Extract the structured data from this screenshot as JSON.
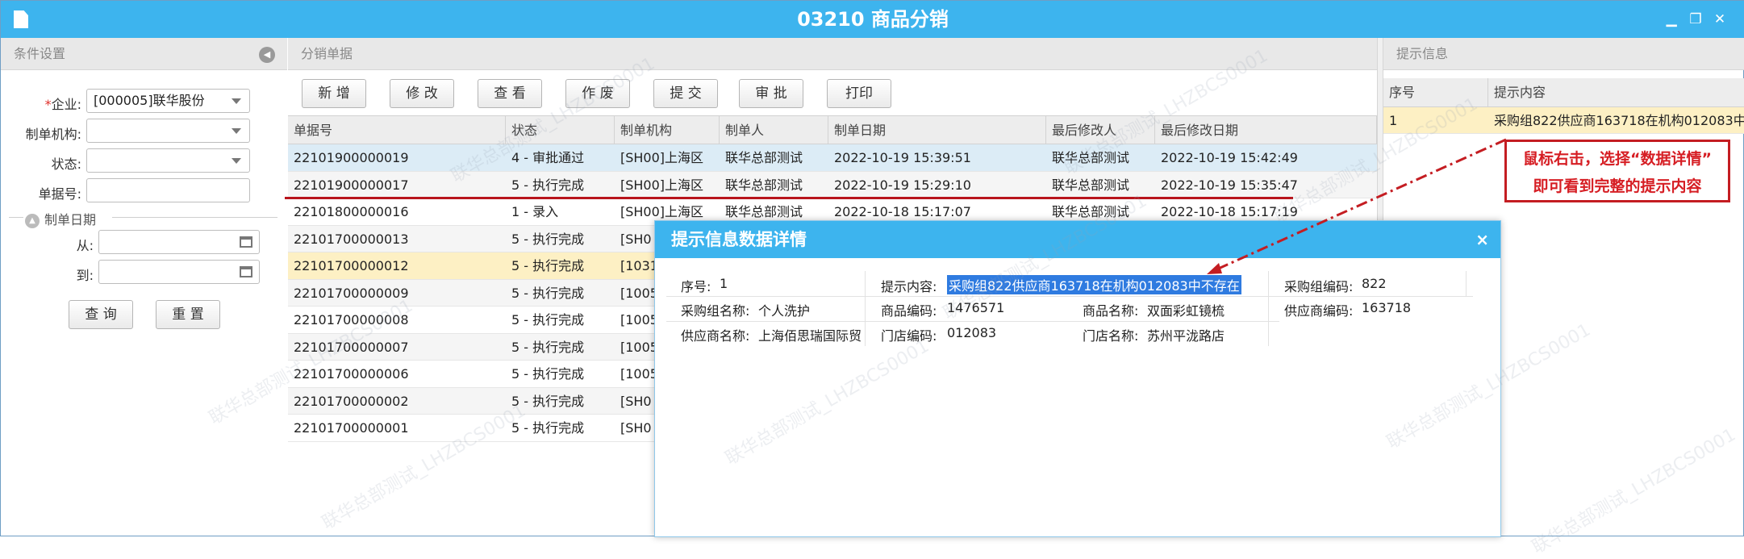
{
  "window": {
    "title": "03210 商品分销",
    "min_glyph": "▁",
    "restore_glyph": "❐",
    "close_glyph": "✕"
  },
  "left": {
    "header": "条件设置",
    "collapse_glyph": "◀",
    "fields": {
      "company_label": "企业:",
      "company_required_mark": "*",
      "company_value": "[000005]联华股份",
      "org_label": "制单机构:",
      "status_label": "状态:",
      "docno_label": "单据号:",
      "date_section": "制单日期",
      "from_label": "从:",
      "to_label": "到:"
    },
    "query_button": "查 询",
    "reset_button": "重 置"
  },
  "main": {
    "header": "分销单据",
    "toolbar": [
      "新 增",
      "修 改",
      "查 看",
      "作 废",
      "提 交",
      "审 批",
      "打印"
    ],
    "columns": [
      "单据号",
      "状态",
      "制单机构",
      "制单人",
      "制单日期",
      "最后修改人",
      "最后修改日期"
    ],
    "rows": [
      [
        "22101900000019",
        "4 - 审批通过",
        "[SH00]上海区",
        "联华总部测试",
        "2022-10-19 15:39:51",
        "联华总部测试",
        "2022-10-19 15:42:49"
      ],
      [
        "22101900000017",
        "5 - 执行完成",
        "[SH00]上海区",
        "联华总部测试",
        "2022-10-19 15:29:10",
        "联华总部测试",
        "2022-10-19 15:35:47"
      ],
      [
        "22101800000016",
        "1 - 录入",
        "[SH00]上海区",
        "联华总部测试",
        "2022-10-18 15:17:07",
        "联华总部测试",
        "2022-10-18 15:17:19"
      ],
      [
        "22101700000013",
        "5 - 执行完成",
        "[SH0",
        "",
        "",
        "",
        ""
      ],
      [
        "22101700000012",
        "5 - 执行完成",
        "[1031",
        "",
        "",
        "",
        ""
      ],
      [
        "22101700000009",
        "5 - 执行完成",
        "[1005",
        "",
        "",
        "",
        ""
      ],
      [
        "22101700000008",
        "5 - 执行完成",
        "[1005",
        "",
        "",
        "",
        ""
      ],
      [
        "22101700000007",
        "5 - 执行完成",
        "[1005",
        "",
        "",
        "",
        ""
      ],
      [
        "22101700000006",
        "5 - 执行完成",
        "[1005",
        "",
        "",
        "",
        ""
      ],
      [
        "22101700000002",
        "5 - 执行完成",
        "[SH0",
        "",
        "",
        "",
        ""
      ],
      [
        "22101700000001",
        "5 - 执行完成",
        "[SH0",
        "",
        "",
        "",
        ""
      ]
    ]
  },
  "hint": {
    "header": "提示信息",
    "columns": [
      "序号",
      "提示内容"
    ],
    "row": [
      "1",
      "采购组822供应商163718在机构012083中"
    ]
  },
  "annotation": {
    "line1": "鼠标右击，选择“数据详情”",
    "line2": "即可看到完整的提示内容",
    "color": "#c41d22"
  },
  "dialog": {
    "title": "提示信息数据详情",
    "close_glyph": "×",
    "fields": {
      "seq_label": "序号:",
      "seq_value": "1",
      "content_label": "提示内容:",
      "content_value": "采购组822供应商163718在机构012083中不存在",
      "group_code_label": "采购组编码:",
      "group_code_value": "822",
      "group_name_label": "采购组名称:",
      "group_name_value": "个人洗护",
      "goods_code_label": "商品编码:",
      "goods_code_value": "1476571",
      "goods_name_label": "商品名称:",
      "goods_name_value": "双面彩虹镜梳",
      "supplier_code_label": "供应商编码:",
      "supplier_code_value": "163718",
      "supplier_name_label": "供应商名称:",
      "supplier_name_value": "上海佰思瑞国际贸",
      "store_code_label": "门店编码:",
      "store_code_value": "012083",
      "store_name_label": "门店名称:",
      "store_name_value": "苏州平泷路店"
    }
  },
  "watermark": "联华总部测试_LHZBCS0001",
  "colors": {
    "accent": "#3db4ee",
    "highlight": "#2f7be0",
    "selected_row": "#fdf0c4"
  }
}
